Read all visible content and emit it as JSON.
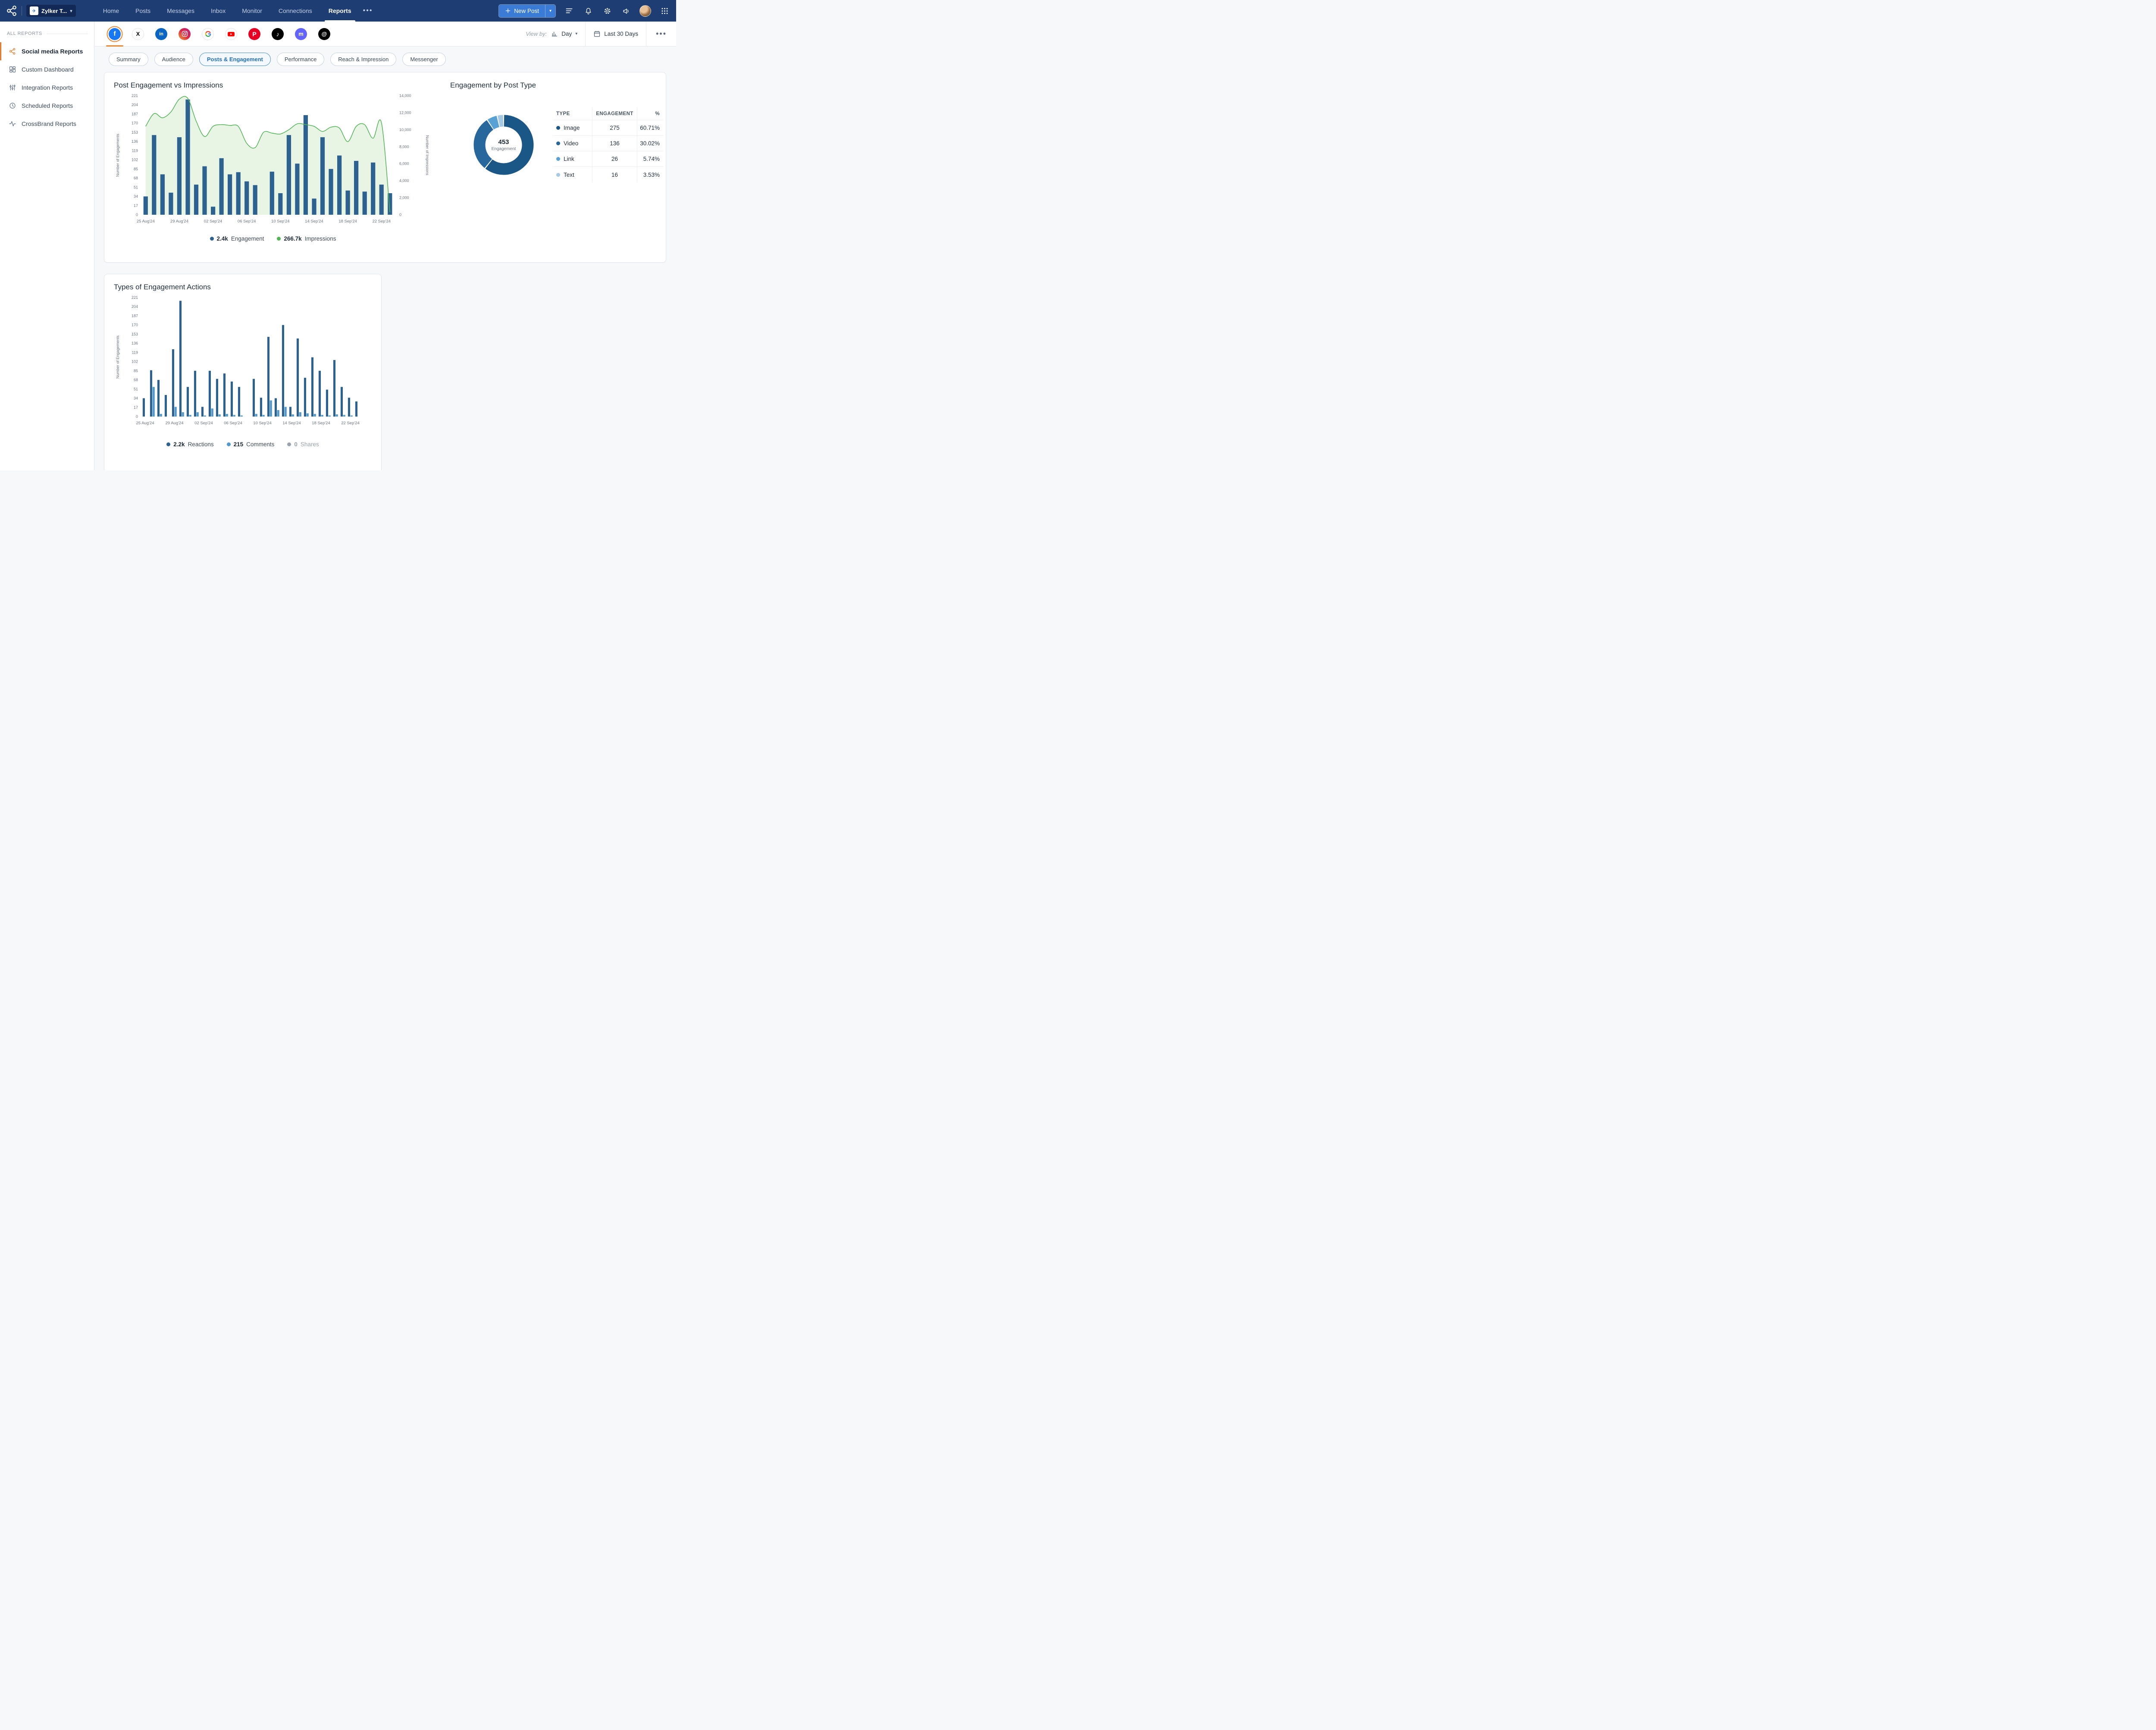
{
  "navbar": {
    "brand_label": "Zylker T...",
    "items": [
      {
        "label": "Home"
      },
      {
        "label": "Posts"
      },
      {
        "label": "Messages"
      },
      {
        "label": "Inbox"
      },
      {
        "label": "Monitor"
      },
      {
        "label": "Connections"
      },
      {
        "label": "Reports"
      }
    ],
    "active_item": "Reports",
    "new_post_label": "New Post"
  },
  "sidebar": {
    "section_label": "ALL REPORTS",
    "items": [
      {
        "label": "Social media Reports",
        "icon": "share-nodes-icon",
        "active": true
      },
      {
        "label": "Custom Dashboard",
        "icon": "dashboard-icon",
        "active": false
      },
      {
        "label": "Integration Reports",
        "icon": "sliders-icon",
        "active": false
      },
      {
        "label": "Scheduled Reports",
        "icon": "clock-icon",
        "active": false
      },
      {
        "label": "CrossBrand Reports",
        "icon": "pulse-icon",
        "active": false
      }
    ]
  },
  "toolbar": {
    "view_by_label": "View by:",
    "view_by_value": "Day",
    "date_range_value": "Last 30 Days"
  },
  "networks": [
    {
      "name": "facebook",
      "selected": true,
      "color": "#1877f2"
    },
    {
      "name": "x-twitter",
      "selected": false,
      "color": "#000000"
    },
    {
      "name": "linkedin",
      "selected": false,
      "color": "#0a66c2"
    },
    {
      "name": "instagram",
      "selected": false,
      "color": "#d62976"
    },
    {
      "name": "google",
      "selected": false,
      "color": "#4285f4"
    },
    {
      "name": "youtube",
      "selected": false,
      "color": "#ff0000"
    },
    {
      "name": "pinterest",
      "selected": false,
      "color": "#e60023"
    },
    {
      "name": "tiktok",
      "selected": false,
      "color": "#000000"
    },
    {
      "name": "mastodon",
      "selected": false,
      "color": "#6364ff"
    },
    {
      "name": "threads",
      "selected": false,
      "color": "#000000"
    }
  ],
  "tabs": {
    "items": [
      {
        "label": "Summary",
        "active": false
      },
      {
        "label": "Audience",
        "active": false
      },
      {
        "label": "Posts & Engagement",
        "active": true
      },
      {
        "label": "Performance",
        "active": false
      },
      {
        "label": "Reach & Impression",
        "active": false
      },
      {
        "label": "Messenger",
        "active": false
      }
    ]
  },
  "chart_data": [
    {
      "type": "bar",
      "subtype": "combo-bar-area-line",
      "title": "Post Engagement vs Impressions",
      "ylabel_left": "Number of Engagements",
      "ylabel_right": "Number of Impressions",
      "ylim_left": [
        0,
        221
      ],
      "ylim_right": [
        0,
        14000
      ],
      "yticks_left": [
        0,
        17,
        34,
        51,
        68,
        85,
        102,
        119,
        136,
        153,
        170,
        187,
        204,
        221
      ],
      "yticks_right": [
        0,
        2000,
        4000,
        6000,
        8000,
        10000,
        12000,
        14000
      ],
      "grid": false,
      "legend_position": "bottom",
      "x": [
        "25 Aug'24",
        "26 Aug'24",
        "27 Aug'24",
        "28 Aug'24",
        "29 Aug'24",
        "30 Aug'24",
        "31 Aug'24",
        "01 Sep'24",
        "02 Sep'24",
        "03 Sep'24",
        "04 Sep'24",
        "05 Sep'24",
        "06 Sep'24",
        "07 Sep'24",
        "08 Sep'24",
        "09 Sep'24",
        "10 Sep'24",
        "11 Sep'24",
        "12 Sep'24",
        "13 Sep'24",
        "14 Sep'24",
        "15 Sep'24",
        "16 Sep'24",
        "17 Sep'24",
        "18 Sep'24",
        "19 Sep'24",
        "20 Sep'24",
        "21 Sep'24",
        "22 Sep'24",
        "23 Sep'24"
      ],
      "x_tick_indices": [
        0,
        4,
        8,
        12,
        16,
        20,
        24,
        28
      ],
      "series": [
        {
          "name": "Engagement",
          "kind": "bar",
          "axis": "left",
          "total_label": "2.4k",
          "color": "#2d6290",
          "values": [
            34,
            148,
            75,
            41,
            144,
            214,
            56,
            90,
            15,
            105,
            75,
            79,
            62,
            55,
            0,
            80,
            40,
            148,
            95,
            185,
            30,
            144,
            85,
            110,
            45,
            100,
            43,
            97,
            56,
            40
          ]
        },
        {
          "name": "Impressions",
          "kind": "area-line",
          "axis": "right",
          "total_label": "266.7k",
          "color": "#53b557",
          "fill": "#d9efd4",
          "values": [
            10400,
            11900,
            11400,
            12100,
            13600,
            13700,
            11000,
            9200,
            10400,
            10600,
            10500,
            10400,
            8400,
            7900,
            9700,
            9600,
            9500,
            10000,
            10700,
            10600,
            10400,
            9800,
            10300,
            10200,
            8600,
            10400,
            10600,
            9000,
            10800,
            300
          ]
        }
      ]
    },
    {
      "type": "pie",
      "subtype": "donut",
      "title": "Engagement by Post Type",
      "center_value": "453",
      "center_label": "Engagement",
      "columns": [
        "TYPE",
        "ENGAGEMENT",
        "%"
      ],
      "slices": [
        {
          "label": "Image",
          "value": 275,
          "pct": "60.71%",
          "color": "#1b5786"
        },
        {
          "label": "Video",
          "value": 136,
          "pct": "30.02%",
          "color": "#27679c"
        },
        {
          "label": "Link",
          "value": 26,
          "pct": "5.74%",
          "color": "#58a1d4"
        },
        {
          "label": "Text",
          "value": 16,
          "pct": "3.53%",
          "color": "#a6c9e6"
        }
      ]
    },
    {
      "type": "bar",
      "subtype": "grouped-bar",
      "title": "Types of Engagement Actions",
      "ylabel": "Number of Engagements",
      "ylim": [
        0,
        221
      ],
      "yticks": [
        0,
        17,
        34,
        51,
        68,
        85,
        102,
        119,
        136,
        153,
        170,
        187,
        204,
        221
      ],
      "grid": false,
      "legend_position": "bottom",
      "x": [
        "25 Aug'24",
        "26 Aug'24",
        "27 Aug'24",
        "28 Aug'24",
        "29 Aug'24",
        "30 Aug'24",
        "31 Aug'24",
        "01 Sep'24",
        "02 Sep'24",
        "03 Sep'24",
        "04 Sep'24",
        "05 Sep'24",
        "06 Sep'24",
        "07 Sep'24",
        "08 Sep'24",
        "09 Sep'24",
        "10 Sep'24",
        "11 Sep'24",
        "12 Sep'24",
        "13 Sep'24",
        "14 Sep'24",
        "15 Sep'24",
        "16 Sep'24",
        "17 Sep'24",
        "18 Sep'24",
        "19 Sep'24",
        "20 Sep'24",
        "21 Sep'24",
        "22 Sep'24",
        "23 Sep'24"
      ],
      "x_tick_indices": [
        0,
        4,
        8,
        12,
        16,
        20,
        24,
        28
      ],
      "series": [
        {
          "name": "Reactions",
          "total_label": "2.2k",
          "color": "#2d6290",
          "values": [
            34,
            86,
            68,
            40,
            125,
            215,
            55,
            85,
            18,
            85,
            70,
            80,
            65,
            55,
            0,
            70,
            35,
            148,
            34,
            170,
            18,
            145,
            72,
            110,
            85,
            50,
            105,
            55,
            35,
            28
          ]
        },
        {
          "name": "Comments",
          "total_label": "215",
          "color": "#5299cd",
          "values": [
            0,
            55,
            5,
            0,
            18,
            8,
            3,
            8,
            2,
            15,
            4,
            5,
            3,
            2,
            0,
            5,
            3,
            30,
            12,
            18,
            4,
            8,
            6,
            5,
            3,
            2,
            4,
            3,
            2,
            0
          ]
        },
        {
          "name": "Shares",
          "total_label": "0",
          "color": "#9ca3af",
          "muted": true,
          "values": [
            0,
            0,
            0,
            0,
            0,
            0,
            0,
            0,
            0,
            0,
            0,
            0,
            0,
            0,
            0,
            0,
            0,
            0,
            0,
            0,
            0,
            0,
            0,
            0,
            0,
            0,
            0,
            0,
            0,
            0
          ]
        }
      ]
    }
  ],
  "colors": {
    "navbar_bg": "#1d3d73",
    "accent_orange": "#e87c2e",
    "primary_blue": "#3a7bd5"
  }
}
